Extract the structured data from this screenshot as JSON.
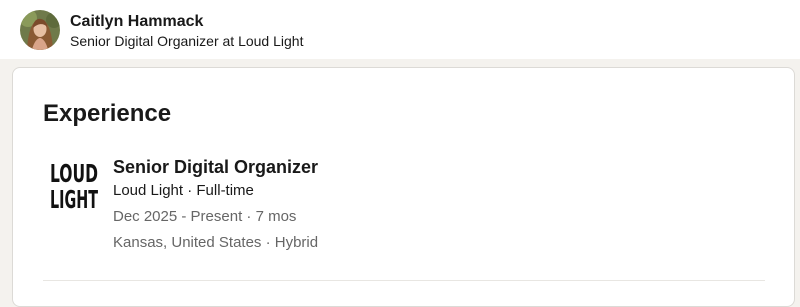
{
  "profile": {
    "name": "Caitlyn Hammack",
    "headline": "Senior Digital Organizer at Loud Light"
  },
  "experience": {
    "section_title": "Experience",
    "items": [
      {
        "logo_lines": [
          "LOUD",
          "LIGHT"
        ],
        "title": "Senior Digital Organizer",
        "company_line": "Loud Light · Full-time",
        "dates": "Dec 2025 - Present · 7 mos",
        "location": "Kansas, United States · Hybrid"
      }
    ]
  },
  "colors": {
    "page_bg": "#f4f2ee",
    "card_bg": "#ffffff",
    "text_primary": "#191919",
    "text_secondary": "#666666"
  }
}
